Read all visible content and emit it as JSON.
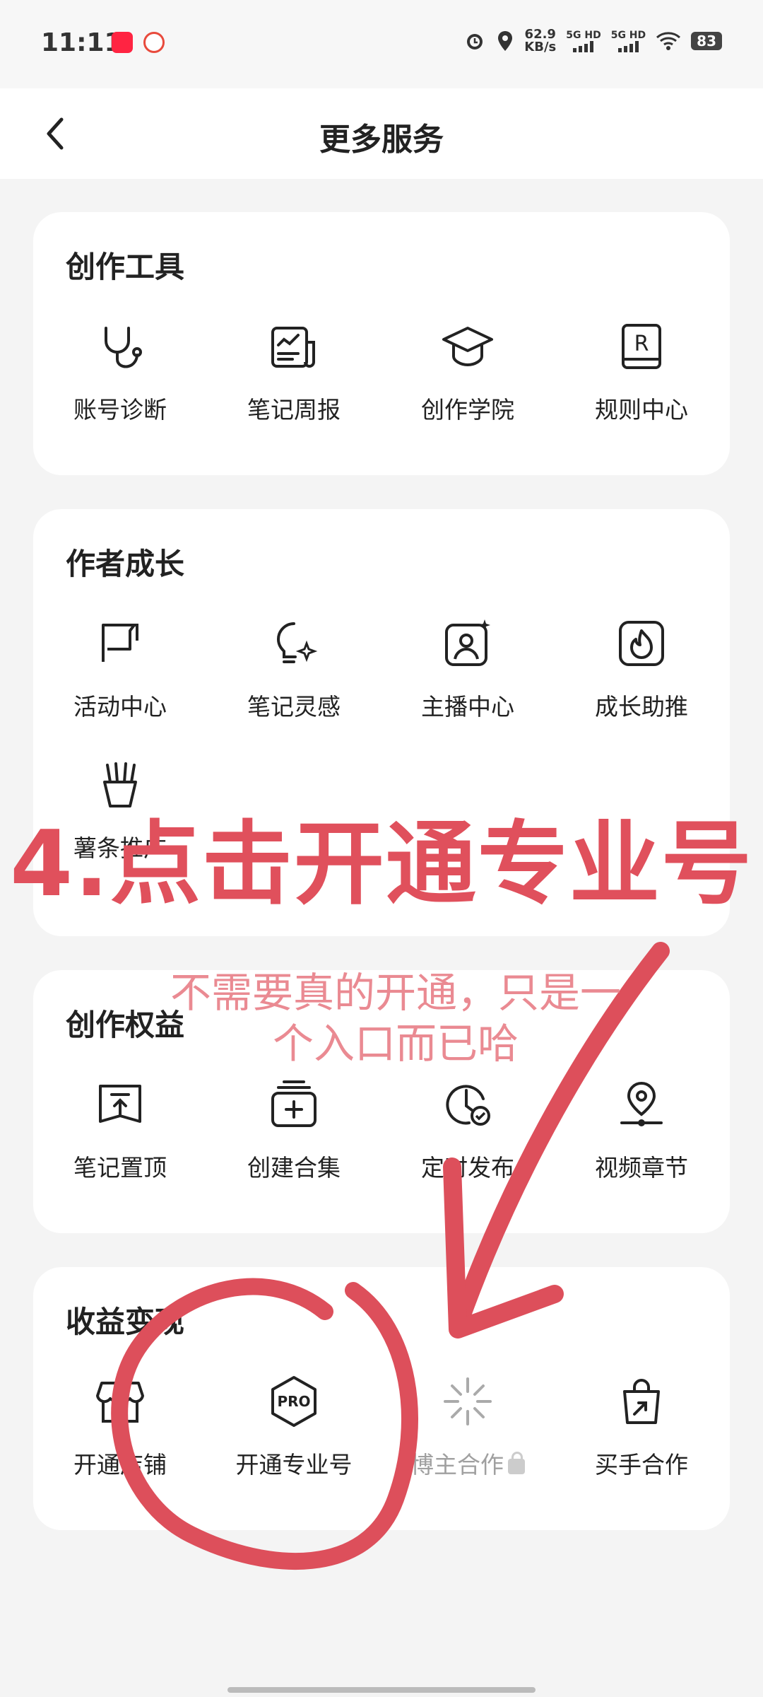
{
  "status_bar": {
    "time": "11:11",
    "app1": "小红书",
    "net_speed_value": "62.9",
    "net_speed_unit": "KB/s",
    "signal1": "5G HD",
    "signal2": "5G HD",
    "battery": "83"
  },
  "header": {
    "title": "更多服务"
  },
  "sections": [
    {
      "title": "创作工具",
      "items": [
        {
          "label": "账号诊断",
          "icon": "stethoscope-icon"
        },
        {
          "label": "笔记周报",
          "icon": "report-chart-icon"
        },
        {
          "label": "创作学院",
          "icon": "graduation-cap-icon"
        },
        {
          "label": "规则中心",
          "icon": "rule-book-icon"
        }
      ]
    },
    {
      "title": "作者成长",
      "items": [
        {
          "label": "活动中心",
          "icon": "flag-icon"
        },
        {
          "label": "笔记灵感",
          "icon": "lightbulb-sparkle-icon"
        },
        {
          "label": "主播中心",
          "icon": "anchor-user-icon"
        },
        {
          "label": "成长助推",
          "icon": "flame-icon"
        },
        {
          "label": "薯条推广",
          "icon": "fries-icon"
        }
      ]
    },
    {
      "title": "创作权益",
      "items": [
        {
          "label": "笔记置顶",
          "icon": "pin-top-icon"
        },
        {
          "label": "创建合集",
          "icon": "collection-add-icon"
        },
        {
          "label": "定时发布",
          "icon": "clock-check-icon"
        },
        {
          "label": "视频章节",
          "icon": "video-chapter-icon"
        }
      ]
    },
    {
      "title": "收益变现",
      "items": [
        {
          "label": "开通店铺",
          "icon": "store-icon"
        },
        {
          "label": "开通专业号",
          "icon": "pro-badge-icon",
          "badge_text": "PRO"
        },
        {
          "label": "博主合作",
          "icon": "sparkle-icon",
          "locked": true
        },
        {
          "label": "买手合作",
          "icon": "shopping-bag-icon"
        }
      ]
    }
  ],
  "overlay": {
    "main_text": "4.点击开通专业号",
    "note_text": "不需要真的开通，只是一个入口而已哈",
    "color": "#e0505c"
  }
}
